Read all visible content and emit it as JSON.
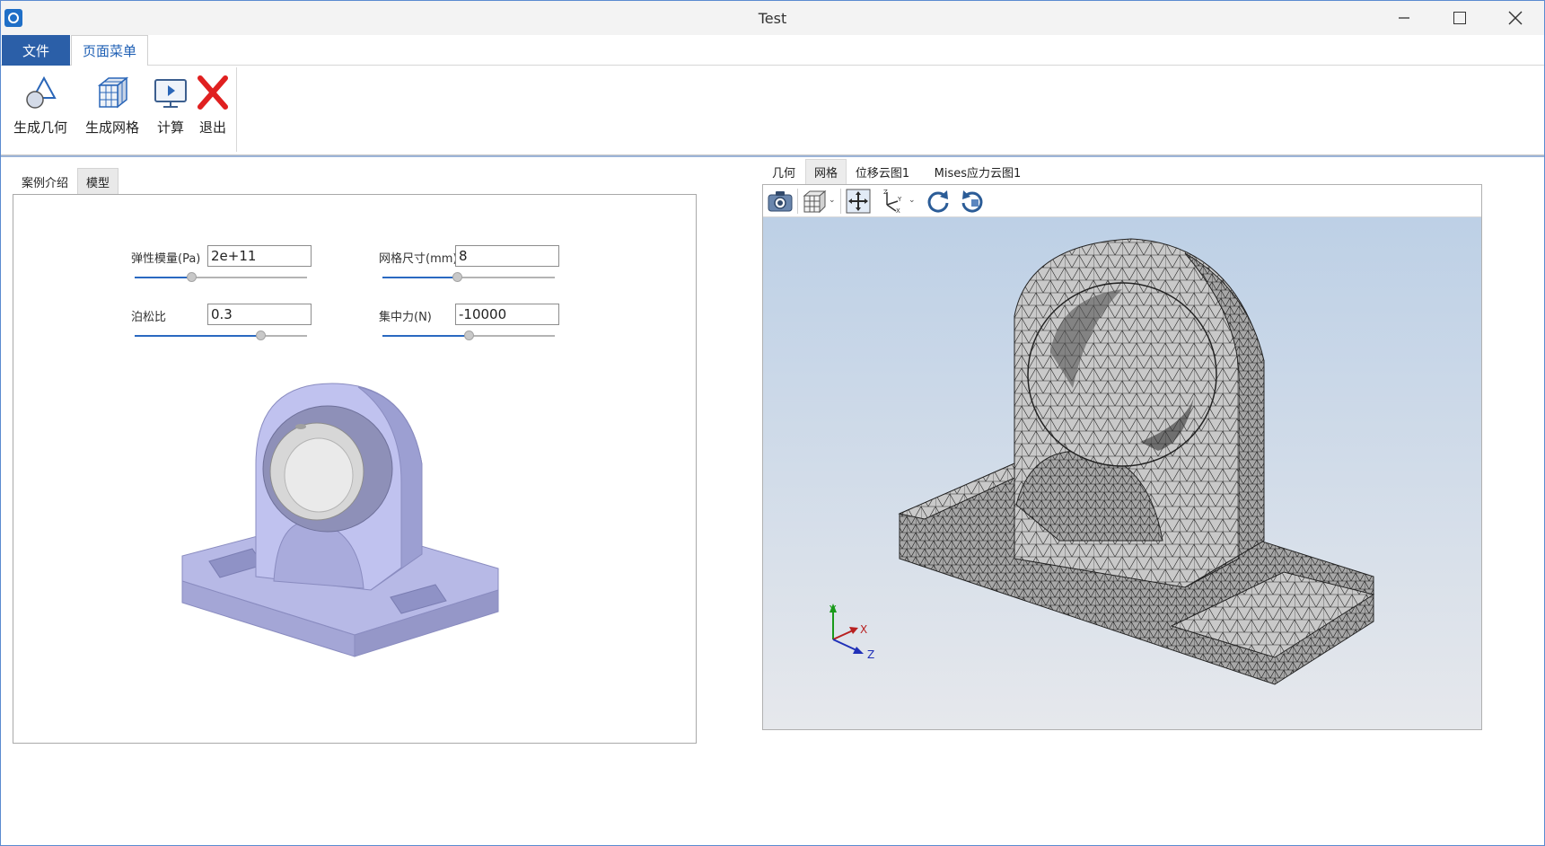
{
  "window": {
    "title": "Test"
  },
  "ribbon": {
    "tabs": [
      {
        "label": "文件"
      },
      {
        "label": "页面菜单"
      }
    ],
    "buttons": [
      {
        "label": "生成几何",
        "icon": "geometry-icon"
      },
      {
        "label": "生成网格",
        "icon": "mesh-cube-icon"
      },
      {
        "label": "计算",
        "icon": "compute-monitor-icon"
      },
      {
        "label": "退出",
        "icon": "exit-x-icon"
      }
    ]
  },
  "left": {
    "tabs": [
      {
        "label": "案例介绍"
      },
      {
        "label": "模型"
      }
    ],
    "active_tab": "模型",
    "params": {
      "elastic": {
        "label": "弹性模量(Pa)",
        "value": "2e+11",
        "slider": 0.33
      },
      "mesh_size": {
        "label": "网格尺寸(mm)",
        "value": "8",
        "slider": 0.43
      },
      "poisson": {
        "label": "泊松比",
        "value": "0.3",
        "slider": 0.73
      },
      "force": {
        "label": "集中力(N)",
        "value": "-10000",
        "slider": 0.5
      }
    }
  },
  "right": {
    "tabs": [
      {
        "label": "几何"
      },
      {
        "label": "网格"
      },
      {
        "label": "位移云图1"
      },
      {
        "label": "Mises应力云图1"
      }
    ],
    "active_tab": "网格",
    "toolbar": [
      "camera-icon",
      "view-cube-icon",
      "fit-view-icon",
      "axis-orientation-icon",
      "rotate-cw-icon",
      "rotate-ccw-icon"
    ],
    "axes": {
      "x": "X",
      "y": "Y",
      "z": "Z"
    }
  },
  "colors": {
    "accent": "#2b5fa8",
    "model": "#b3b6e6",
    "mesh": "#c4c4c4"
  }
}
